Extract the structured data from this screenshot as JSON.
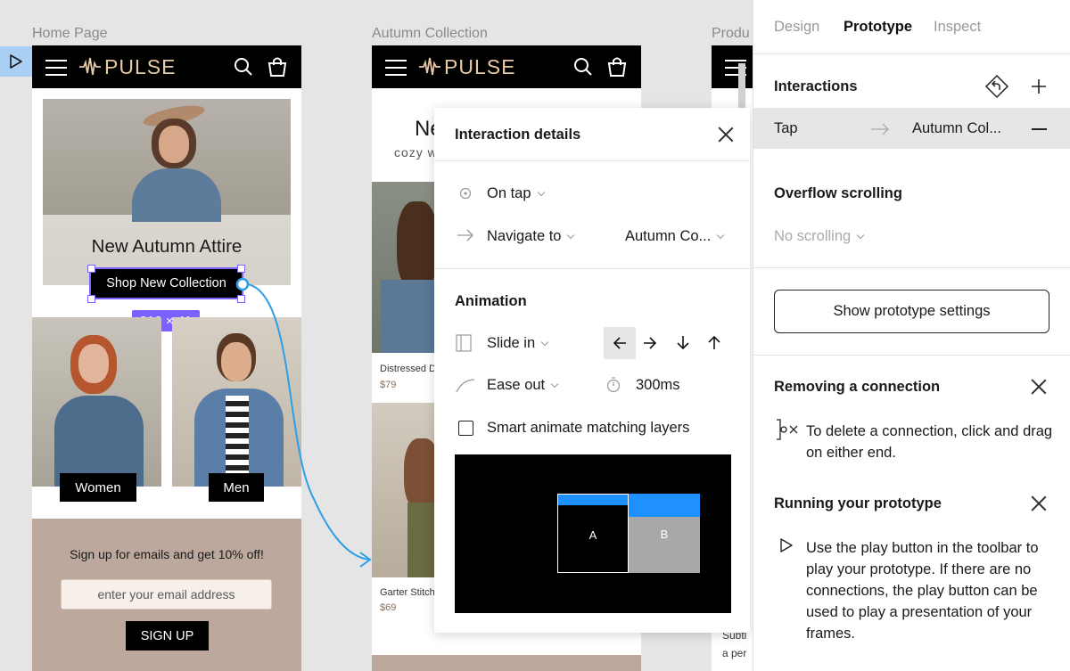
{
  "frames": {
    "home_label": "Home Page",
    "autumn_label": "Autumn Collection",
    "product_label": "Produ"
  },
  "brand": {
    "name": "PULSE"
  },
  "home": {
    "hero_title": "New Autumn Attire",
    "hero_button": "Shop New Collection",
    "dimension_badge": "210 × 41",
    "women_button": "Women",
    "men_button": "Men",
    "signup_text": "Sign up for emails and get 10% off!",
    "email_placeholder": "enter your email address",
    "signup_button": "SIGN UP"
  },
  "autumn": {
    "title_partial": "Ne",
    "subtitle_partial": "cozy w",
    "item1_name": "Distressed D",
    "item1_price": "$79",
    "item2_name": "Garter Stitch",
    "item2_price": "$69"
  },
  "product": {
    "text_line1": "Subtl",
    "text_line2": "a per"
  },
  "dialog": {
    "title": "Interaction details",
    "trigger": "On tap",
    "action": "Navigate to",
    "destination": "Autumn Co...",
    "animation_heading": "Animation",
    "animation_type": "Slide in",
    "easing": "Ease out",
    "duration": "300ms",
    "smart_animate": "Smart animate matching layers",
    "preview_a": "A",
    "preview_b": "B"
  },
  "right_panel": {
    "tabs": [
      "Design",
      "Prototype",
      "Inspect"
    ],
    "active_tab": "Prototype",
    "interactions_heading": "Interactions",
    "interaction_trigger": "Tap",
    "interaction_target": "Autumn Col...",
    "overflow_heading": "Overflow scrolling",
    "overflow_value": "No scrolling",
    "settings_button": "Show prototype settings",
    "removing_heading": "Removing a connection",
    "removing_text": "To delete a connection, click and drag on either end.",
    "running_heading": "Running your prototype",
    "running_text": "Use the play button in the toolbar to play your prototype. If there are no connections, the play button can be used to play a presentation of your frames."
  },
  "colors": {
    "accent_blue": "#1e90ff",
    "selection_purple": "#7b61ff",
    "logo_tan": "#e8c9a6",
    "signup_bg": "#bca89c"
  }
}
